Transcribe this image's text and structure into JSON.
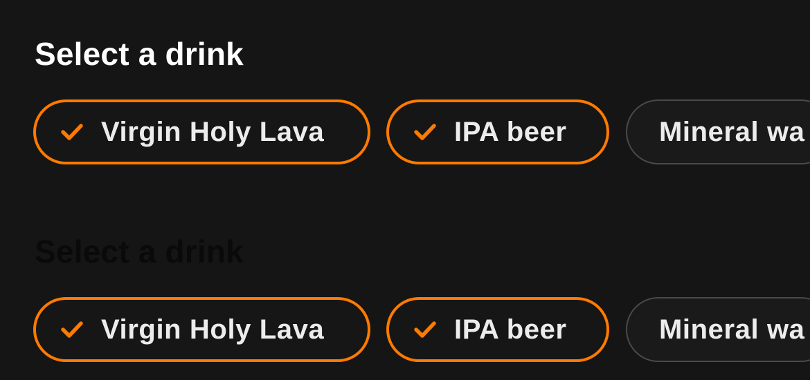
{
  "sections": [
    {
      "title": "Select a drink",
      "options": [
        {
          "label": "Virgin Holy Lava",
          "selected": true,
          "icon": "checkmark-icon"
        },
        {
          "label": "IPA beer",
          "selected": true,
          "icon": "checkmark-icon"
        },
        {
          "label": "Mineral wa",
          "selected": false
        }
      ]
    },
    {
      "title": "Select a drink",
      "options": [
        {
          "label": "Virgin Holy Lava",
          "selected": true,
          "icon": "checkmark-icon"
        },
        {
          "label": "IPA beer",
          "selected": true,
          "icon": "checkmark-icon"
        },
        {
          "label": "Mineral wa",
          "selected": false
        }
      ]
    }
  ],
  "colors": {
    "background": "#151515",
    "accent": "#ff7a00",
    "chip_border_unselected": "#4a4a4a",
    "text": "#ececec",
    "title": "#ffffff",
    "title_dim": "#0a0a0a"
  }
}
